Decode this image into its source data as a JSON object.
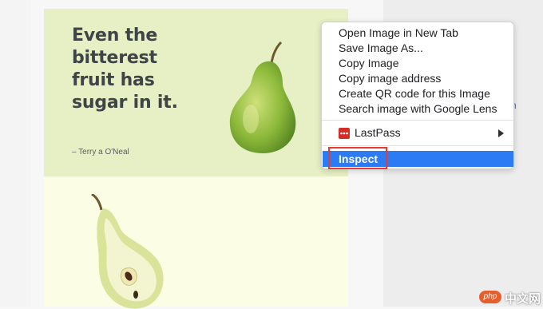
{
  "card": {
    "quote_lines": [
      "Even the",
      "bitterest",
      "fruit has",
      "sugar in it."
    ],
    "author": "– Terry a O'Neal"
  },
  "context_menu": {
    "items": [
      "Open Image in New Tab",
      "Save Image As...",
      "Copy Image",
      "Copy image address",
      "Create QR code for this Image",
      "Search image with Google Lens"
    ],
    "extension_item": "LastPass",
    "inspect": "Inspect"
  },
  "colors": {
    "menu_highlight": "#2d7bf4",
    "annotation_box": "#e53b34",
    "card_top_bg": "#e7f0c4",
    "card_bottom_bg": "#fbfde4"
  },
  "watermark": {
    "badge": "php",
    "text": "中文网"
  }
}
